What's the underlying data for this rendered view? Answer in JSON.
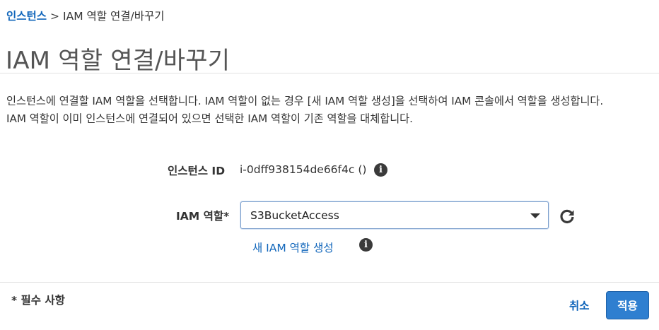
{
  "breadcrumb": {
    "parent": "인스턴스",
    "separator": ">",
    "current": "IAM 역할 연결/바꾸기"
  },
  "page_title": "IAM 역할 연결/바꾸기",
  "description": {
    "line1": "인스턴스에 연결할 IAM 역할을 선택합니다. IAM 역할이 없는 경우 [새 IAM 역할 생성]을 선택하여 IAM 콘솔에서 역할을 생성합니다.",
    "line2": "IAM 역할이 이미 인스턴스에 연결되어 있으면 선택한 IAM 역할이 기존 역할을 대체합니다."
  },
  "instance": {
    "label": "인스턴스 ID",
    "value": "i-0dff938154de66f4c ()"
  },
  "iam_role": {
    "label": "IAM 역할*",
    "selected": "S3BucketAccess"
  },
  "create_role_link": "새 IAM 역할 생성",
  "footer": {
    "required_note": "* 필수 사항",
    "cancel_label": "취소",
    "apply_label": "적용"
  },
  "icons": {
    "info": "i",
    "info_icon_name": "info-icon",
    "refresh_icon_name": "refresh-icon",
    "dropdown_icon_name": "caret-down-icon"
  },
  "colors": {
    "link": "#1166bb",
    "primary_button": "#2f7fd0",
    "select_border": "#7c9fcc"
  }
}
